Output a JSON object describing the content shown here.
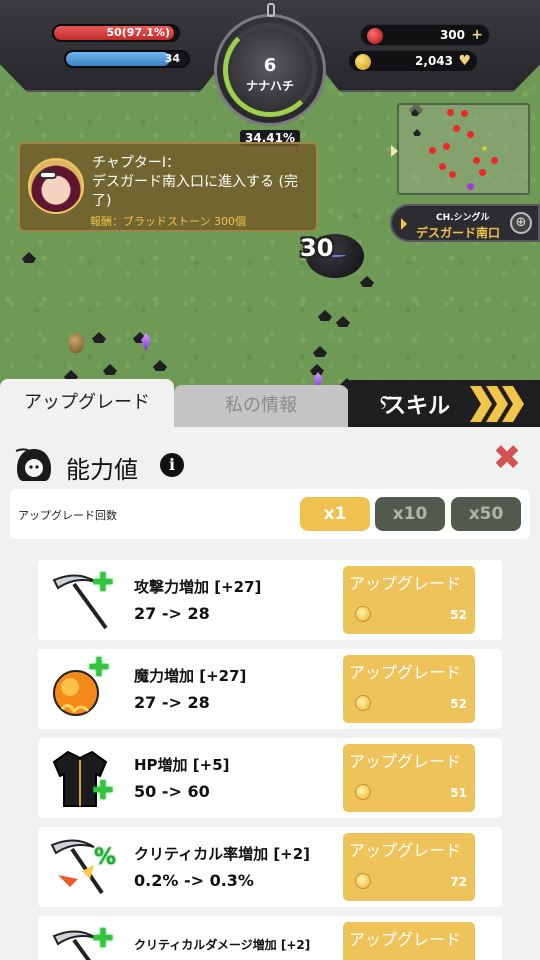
{
  "hud": {
    "hp_text": "50(97.1%)",
    "hp_fraction": 0.97,
    "mp_text": "34",
    "mp_fraction": 0.85,
    "gems": "300",
    "gold": "2,043",
    "level": "6",
    "player_name": "ナナハチ",
    "exp_percent": "34.41%"
  },
  "quest": {
    "title": "チャプターI：",
    "description": "デスガード南入口に進入する (完了)",
    "reward": "報酬：ブラッドストーン 300個"
  },
  "channel": {
    "type": "CH.シングル",
    "name": "デスガード南口"
  },
  "field": {
    "damage_number": "30"
  },
  "tabs": {
    "upgrade": "アップグレード",
    "info": "私の情報",
    "skill": "スキル"
  },
  "panel": {
    "title": "能力値",
    "info_glyph": "i",
    "close_glyph": "✖",
    "count_label": "アップグレード回数",
    "multipliers": [
      "x1",
      "x10",
      "x50"
    ],
    "button_label": "アップグレード",
    "rows": [
      {
        "name": "攻撃力増加 [+27]",
        "value": "27 -> 28",
        "cost": "52",
        "icon": "scythe-icon"
      },
      {
        "name": "魔力増加 [+27]",
        "value": "27 -> 28",
        "cost": "52",
        "icon": "fire-orb-icon"
      },
      {
        "name": "HP増加 [+5]",
        "value": "50 -> 60",
        "cost": "51",
        "icon": "jacket-icon"
      },
      {
        "name": "クリティカル率増加 [+2]",
        "value": "0.2% -> 0.3%",
        "cost": "72",
        "icon": "critical-scythe-icon"
      },
      {
        "name": "クリティカルダメージ増加 [+2]",
        "value": "",
        "cost": "",
        "icon": "scythe-icon"
      }
    ]
  }
}
